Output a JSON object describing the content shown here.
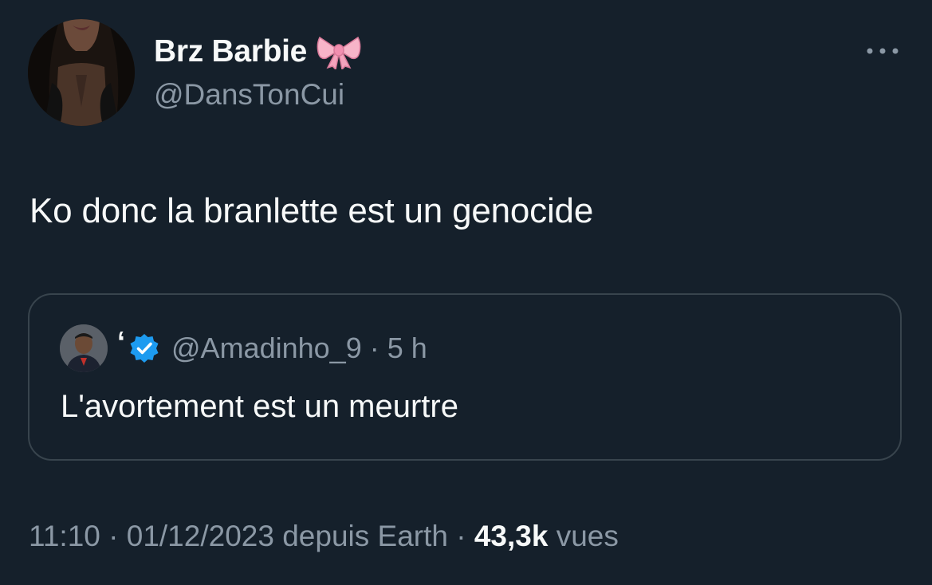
{
  "author": {
    "display_name": "Brz Barbie",
    "name_emoji": "ribbon-bow-icon",
    "handle": "@DansTonCui"
  },
  "more_icon": "more-options-icon",
  "tweet": {
    "text": "Ko donc la branlette est un genocide"
  },
  "quote": {
    "author_name": "‘",
    "verified": true,
    "handle": "@Amadinho_9",
    "separator": "·",
    "time": "5 h",
    "text": "L'avortement est un meurtre"
  },
  "meta": {
    "time": "11:10",
    "sep1": "·",
    "date": "01/12/2023",
    "source": "depuis Earth",
    "sep2": "·",
    "views_count": "43,3k",
    "views_label": "vues"
  },
  "colors": {
    "background": "#15202b",
    "primary_text": "#f7f9f9",
    "secondary_text": "#8b98a5",
    "border": "#38444d",
    "verified_blue": "#1d9bf0",
    "bow_pink": "#f7b4c8"
  }
}
